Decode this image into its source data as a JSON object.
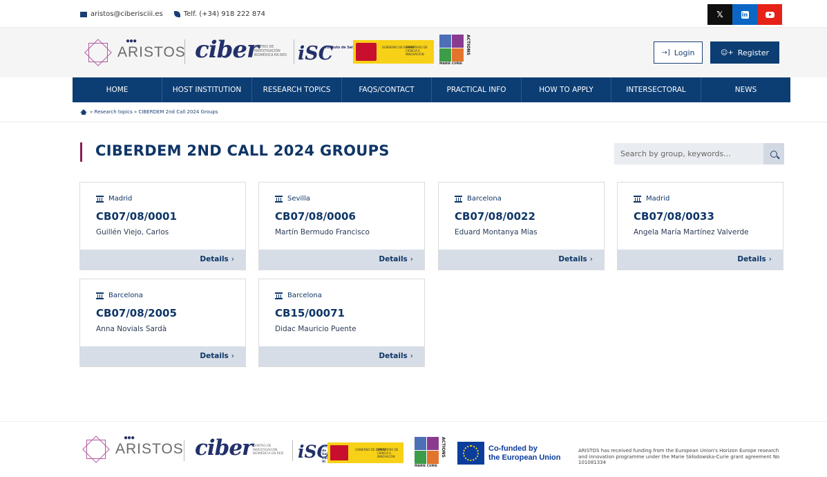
{
  "topbar": {
    "email": "aristos@ciberisciii.es",
    "phone": "Telf. (+34) 918 222 874",
    "social": {
      "x_label": "𝕏",
      "linkedin_label": "in"
    }
  },
  "header": {
    "brand": "ARISTOS",
    "ciber": "ciber",
    "ciber_sub": "CENTRO DE INVESTIGACIÓN BIOMÉDICA EN RED",
    "isc": "iSC",
    "isc_sub": "Instituto de Salud Carlos III",
    "gob_1": "GOBIERNO DE ESPAÑA",
    "gob_2": "MINISTERIO DE CIENCIA E INNOVACIÓN",
    "marie_caption": "MARIE CURIE",
    "marie_vertical": "ACTIONS",
    "login": "Login",
    "register": "Register"
  },
  "nav": [
    {
      "label": "HOME",
      "w": 130
    },
    {
      "label": "HOST INSTITUTION",
      "w": 130
    },
    {
      "label": "RESEARCH TOPICS",
      "w": 130
    },
    {
      "label": "FAQS/CONTACT",
      "w": 130
    },
    {
      "label": "PRACTICAL INFO",
      "w": 130
    },
    {
      "label": "HOW TO APPLY",
      "w": 130
    },
    {
      "label": "INTERSECTORAL",
      "w": 130
    },
    {
      "label": "NEWS",
      "w": 129
    }
  ],
  "breadcrumb": {
    "sep": "»",
    "item1": "Research topics",
    "item2": "CIBERDEM 2nd Call 2024 Groups"
  },
  "page": {
    "title": "CIBERDEM 2ND CALL 2024 GROUPS",
    "search_placeholder": "Search by group, keywords..."
  },
  "groups": [
    {
      "city": "Madrid",
      "code": "CB07/08/0001",
      "person": "Guillén Viejo, Carlos",
      "details": "Details"
    },
    {
      "city": "Sevilla",
      "code": "CB07/08/0006",
      "person": "Martín Bermudo Francisco",
      "details": "Details"
    },
    {
      "city": "Barcelona",
      "code": "CB07/08/0022",
      "person": "Eduard Montanya Mias",
      "details": "Details"
    },
    {
      "city": "Madrid",
      "code": "CB07/08/0033",
      "person": "Angela María Martínez Valverde",
      "details": "Details"
    },
    {
      "city": "Barcelona",
      "code": "CB07/08/2005",
      "person": "Anna Novials Sardà",
      "details": "Details"
    },
    {
      "city": "Barcelona",
      "code": "CB15/00071",
      "person": "Didac Mauricio Puente",
      "details": "Details"
    }
  ],
  "footer": {
    "brand": "ARISTOS",
    "ciber": "ciber",
    "ciber_sub": "CENTRO DE INVESTIGACIÓN BIOMÉDICA EN RED",
    "isc": "iSC",
    "isc_sub": "Instituto de Salud Carlos III",
    "gob_1": "GOBIERNO DE ESPAÑA",
    "gob_2": "MINISTERIO DE CIENCIA E INNOVACIÓN",
    "marie_caption": "MARIE CURIE",
    "marie_vertical": "ACTIONS",
    "eu_line1": "Co-funded by",
    "eu_line2": "the European Union",
    "note": "ARISTOS has received funding from the European Union's Horizon Europe research and innovation programme under the Marie Skłodowska-Curie grant agreement No 101081334"
  }
}
